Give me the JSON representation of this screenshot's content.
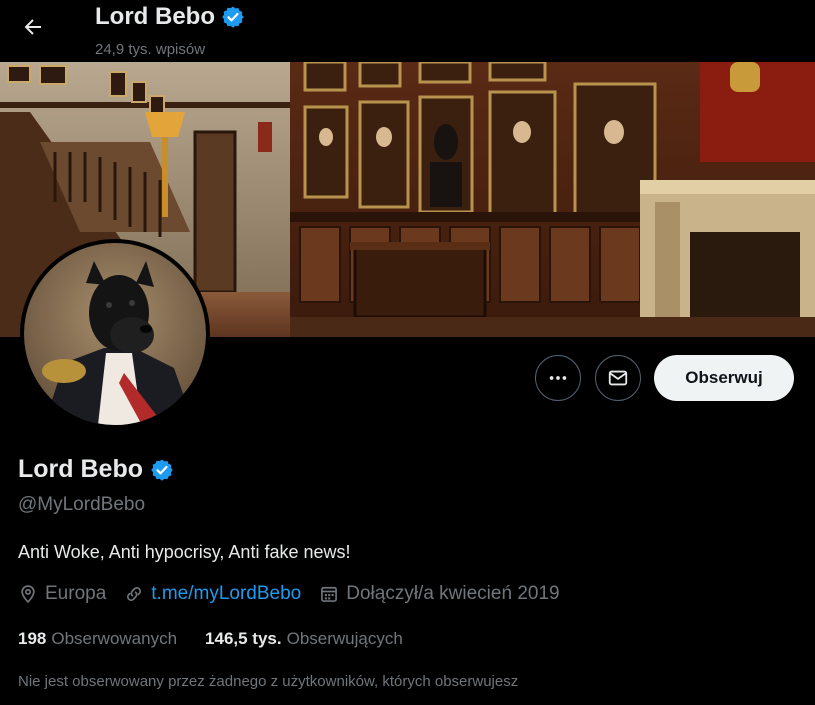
{
  "header": {
    "title": "Lord Bebo",
    "posts_count": "24,9 tys. wpisów"
  },
  "profile": {
    "display_name": "Lord Bebo",
    "handle": "@MyLordBebo",
    "bio": "Anti Woke, Anti hypocrisy, Anti fake news!",
    "location": "Europa",
    "link": "t.me/myLordBebo",
    "joined": "Dołączył/a kwiecień 2019",
    "following_count": "198",
    "following_label": "Obserwowanych",
    "followers_count": "146,5 tys.",
    "followers_label": "Obserwujących",
    "followed_by_notice": "Nie jest obserwowany przez żadnego z użytkowników, których obserwujesz"
  },
  "actions": {
    "follow_label": "Obserwuj"
  },
  "icons": {
    "back": "arrow-left-icon",
    "verified": "verified-badge-icon",
    "more": "more-dots-icon",
    "message": "envelope-icon",
    "location": "location-pin-icon",
    "link": "link-icon",
    "calendar": "calendar-icon"
  },
  "colors": {
    "verified": "#1d9bf0",
    "link": "#1d9bf0",
    "secondary_text": "#71767b",
    "follow_button_bg": "#eff3f4"
  }
}
